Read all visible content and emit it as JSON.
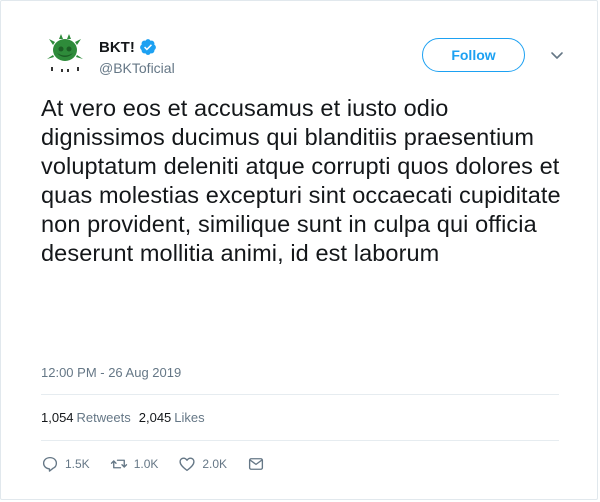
{
  "user": {
    "display_name": "BKT!",
    "handle": "@BKToficial",
    "avatar_icon": "bkt-logo-icon",
    "verified_icon": "verified-badge-icon"
  },
  "follow": {
    "label": "Follow"
  },
  "menu_icon": "chevron-down-icon",
  "tweet": {
    "text": "At vero eos et accusamus et iusto odio dignissimos ducimus qui blanditiis praesentium voluptatum deleniti atque corrupti quos dolores et quas molestias excepturi sint occaecati cupiditate non provident, similique sunt in culpa qui officia deserunt mollitia animi, id est laborum",
    "timestamp": "12:00 PM - 26 Aug 2019"
  },
  "stats": {
    "retweets_count": "1,054",
    "retweets_label": "Retweets",
    "likes_count": "2,045",
    "likes_label": "Likes"
  },
  "actions": {
    "reply_count": "1.5K",
    "retweet_count": "1.0K",
    "like_count": "2.0K"
  },
  "colors": {
    "accent": "#1da1f2",
    "text": "#14171a",
    "secondary": "#657786",
    "border": "#e1e8ed"
  }
}
